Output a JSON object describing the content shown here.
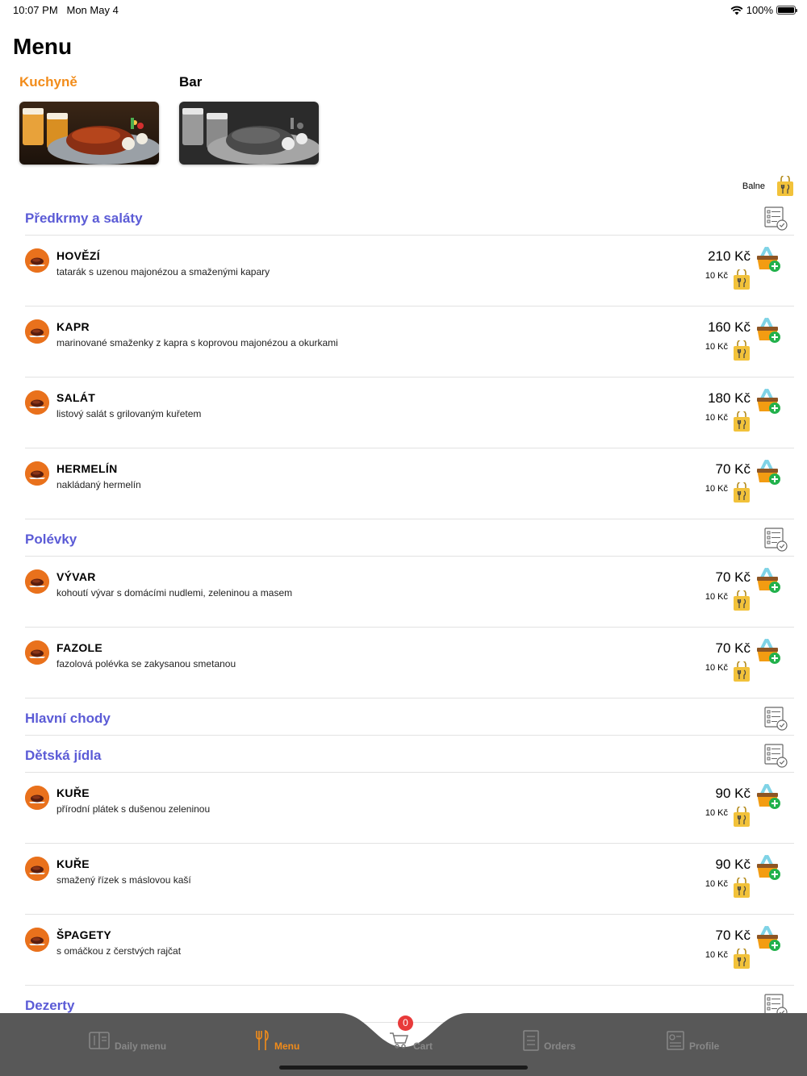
{
  "status_bar": {
    "time": "10:07 PM",
    "date": "Mon May 4",
    "battery": "100%"
  },
  "header": {
    "title": "Menu"
  },
  "categories": [
    {
      "label": "Kuchyně",
      "active": true
    },
    {
      "label": "Bar",
      "active": false
    }
  ],
  "balne_label": "Balne",
  "sections": [
    {
      "title": "Předkrmy a saláty",
      "items": [
        {
          "name": "HOVĚZÍ",
          "desc": "tatarák s uzenou majonézou a smaženými kapary",
          "price": "210 Kč",
          "pack": "10 Kč"
        },
        {
          "name": "KAPR",
          "desc": "marinované smaženky z kapra s koprovou majonézou a okurkami",
          "price": "160 Kč",
          "pack": "10 Kč"
        },
        {
          "name": "SALÁT",
          "desc": "listový salát s grilovaným kuřetem",
          "price": "180 Kč",
          "pack": "10 Kč"
        },
        {
          "name": "HERMELÍN",
          "desc": "nakládaný hermelín",
          "price": "70 Kč",
          "pack": "10 Kč"
        }
      ]
    },
    {
      "title": "Polévky",
      "items": [
        {
          "name": "VÝVAR",
          "desc": "kohoutí vývar s domácími nudlemi, zeleninou a masem",
          "price": "70 Kč",
          "pack": "10 Kč"
        },
        {
          "name": "FAZOLE",
          "desc": "fazolová polévka se zakysanou smetanou",
          "price": "70 Kč",
          "pack": "10 Kč"
        }
      ]
    },
    {
      "title": "Hlavní chody",
      "items": []
    },
    {
      "title": "Dětská jídla",
      "items": [
        {
          "name": "KUŘE",
          "desc": "přírodní plátek s dušenou zeleninou",
          "price": "90 Kč",
          "pack": "10 Kč"
        },
        {
          "name": "KUŘE",
          "desc": "smažený řízek s máslovou kaší",
          "price": "90 Kč",
          "pack": "10 Kč"
        },
        {
          "name": "ŠPAGETY",
          "desc": "s omáčkou z čerstvých rajčat",
          "price": "70 Kč",
          "pack": "10 Kč"
        }
      ]
    },
    {
      "title": "Dezerty",
      "items": []
    }
  ],
  "tabbar": {
    "items": [
      {
        "label": "Daily menu",
        "icon": "daily-menu-icon"
      },
      {
        "label": "Menu",
        "icon": "fork-knife-icon",
        "active": true
      },
      {
        "label": "Cart",
        "icon": "cart-icon"
      },
      {
        "label": "Orders",
        "icon": "orders-icon"
      },
      {
        "label": "Profile",
        "icon": "profile-icon"
      }
    ],
    "cart_count": "0"
  },
  "colors": {
    "accent": "#f28c1a",
    "section": "#5b5bd6",
    "tabbar": "#585858",
    "badge": "#e83a3a"
  }
}
